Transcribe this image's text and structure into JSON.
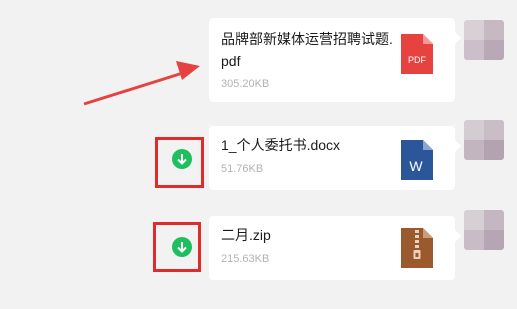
{
  "messages": [
    {
      "filename": "品牌部新媒体运营招聘试题.pdf",
      "size": "305.20KB",
      "file_type": "pdf",
      "file_icon_label": "PDF",
      "icon_color": "#e64340",
      "has_download": false
    },
    {
      "filename": "1_个人委托书.docx",
      "size": "51.76KB",
      "file_type": "docx",
      "file_icon_label": "W",
      "icon_color": "#2b579a",
      "has_download": true
    },
    {
      "filename": "二月.zip",
      "size": "215.63KB",
      "file_type": "zip",
      "file_icon_label": "",
      "icon_color": "#9a5a2e",
      "has_download": true
    }
  ],
  "colors": {
    "background": "#f2f2f2",
    "bubble": "#ffffff",
    "download": "#1fbf5f",
    "annotation": "#e02b2b"
  },
  "icons": {
    "download": "download-arrow-icon",
    "annotation_arrow": "annotation-arrow"
  }
}
